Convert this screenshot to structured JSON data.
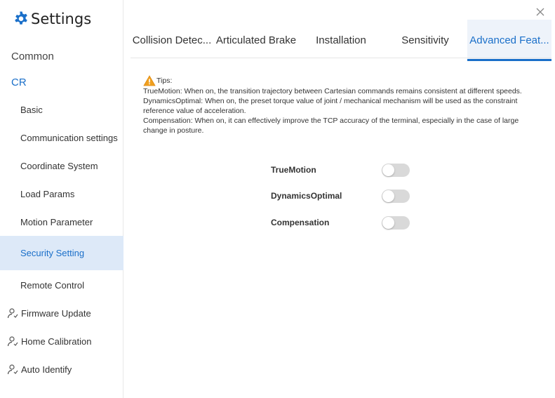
{
  "app": {
    "title": "Settings",
    "icon": "gear-icon",
    "accent": "#1a6fc9"
  },
  "sidebar": {
    "sections": [
      {
        "label": "Common"
      },
      {
        "label": "CR"
      }
    ],
    "cr_items": [
      {
        "label": "Basic"
      },
      {
        "label": "Communication settings"
      },
      {
        "label": "Coordinate System"
      },
      {
        "label": "Load Params"
      },
      {
        "label": "Motion Parameter"
      },
      {
        "label": "Security Setting"
      },
      {
        "label": "Remote Control"
      }
    ],
    "icon_items": [
      {
        "label": "Firmware Update",
        "icon": "person-icon"
      },
      {
        "label": "Home Calibration",
        "icon": "person-icon"
      },
      {
        "label": "Auto Identify",
        "icon": "person-icon"
      }
    ],
    "selected": "Security Setting"
  },
  "tabs": [
    {
      "label": "Collision Detec..."
    },
    {
      "label": "Articulated Brake"
    },
    {
      "label": "Installation"
    },
    {
      "label": "Sensitivity"
    },
    {
      "label": "Advanced Feat..."
    }
  ],
  "active_tab": "Advanced Feat...",
  "tips": {
    "title": "Tips:",
    "lines": [
      "TrueMotion: When on, the transition trajectory between Cartesian commands remains consistent at different speeds.",
      "DynamicsOptimal: When on, the preset torque value of joint / mechanical mechanism will be used as the constraint reference value of acceleration.",
      "Compensation: When on, it can effectively improve the TCP accuracy of the terminal, especially in the case of large change in posture."
    ]
  },
  "options": [
    {
      "label": "TrueMotion",
      "enabled": false
    },
    {
      "label": "DynamicsOptimal",
      "enabled": false
    },
    {
      "label": "Compensation",
      "enabled": false
    }
  ]
}
